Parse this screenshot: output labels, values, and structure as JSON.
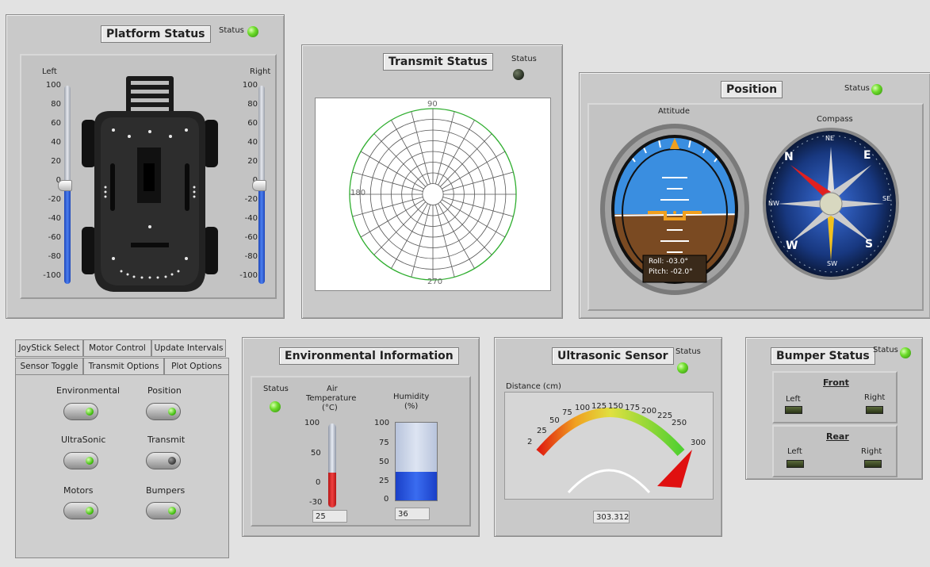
{
  "platform": {
    "title": "Platform Status",
    "status_label": "Status",
    "left_label": "Left",
    "right_label": "Right",
    "scale": [
      "100",
      "80",
      "60",
      "40",
      "20",
      "0",
      "-20",
      "-40",
      "-60",
      "-80",
      "-100"
    ],
    "left_value": 0,
    "right_value": 0,
    "status": "on"
  },
  "transmit": {
    "title": "Transmit Status",
    "status_label": "Status",
    "status": "off",
    "polar_labels": {
      "top": "90",
      "left": "180",
      "bottom": "270"
    }
  },
  "position": {
    "title": "Position",
    "status_label": "Status",
    "status": "on",
    "attitude_label": "Attitude",
    "compass_label": "Compass",
    "roll_text": "Roll:   -03.0°",
    "pitch_text": "Pitch: -02.0°",
    "compass_dirs": {
      "n": "N",
      "ne": "NE",
      "e": "E",
      "se": "SE",
      "s": "S",
      "sw": "SW",
      "w": "W",
      "nw": "NW"
    }
  },
  "tabs": {
    "row1": [
      "JoyStick Select",
      "Motor Control",
      "Update Intervals"
    ],
    "row2": [
      "Sensor Toggle",
      "Transmit Options",
      "Plot Options"
    ],
    "active": "Sensor Toggle",
    "toggles": [
      {
        "label": "Environmental",
        "state": "on"
      },
      {
        "label": "Position",
        "state": "on"
      },
      {
        "label": "UltraSonic",
        "state": "on"
      },
      {
        "label": "Transmit",
        "state": "off"
      },
      {
        "label": "Motors",
        "state": "on"
      },
      {
        "label": "Bumpers",
        "state": "on"
      }
    ]
  },
  "environment": {
    "title": "Environmental Information",
    "status_label": "Status",
    "status": "on",
    "air_label": "Air Temperature (°C)",
    "air_line1": "Air",
    "air_line2": "Temperature",
    "air_line3": "(°C)",
    "temp_scale": [
      "100",
      "50",
      "0",
      "-30"
    ],
    "temp_value": "25",
    "humidity_line1": "Humidity",
    "humidity_line2": "(%)",
    "hum_scale": [
      "100",
      "75",
      "50",
      "25",
      "0"
    ],
    "humidity_value": "36"
  },
  "ultrasonic": {
    "title": "Ultrasonic Sensor",
    "status_label": "Status",
    "status": "on",
    "distance_label": "Distance (cm)",
    "gauge_ticks": [
      "2",
      "25",
      "50",
      "75",
      "100",
      "125",
      "150",
      "175",
      "200",
      "225",
      "250",
      "300"
    ],
    "reading": "303.312"
  },
  "bumper": {
    "title": "Bumper Status",
    "status_label": "Status",
    "status": "on",
    "front_label": "Front",
    "rear_label": "Rear",
    "left_label": "Left",
    "right_label": "Right"
  },
  "colors": {
    "led_on": "#6ddc2a",
    "slider_fill": "#2a5cd8",
    "panel": "#c9c9c9"
  }
}
